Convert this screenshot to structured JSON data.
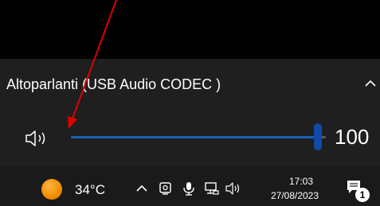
{
  "flyout": {
    "device_label": "Altoparlanti (USB Audio CODEC )",
    "volume_value": "100",
    "volume_level": 1.0
  },
  "taskbar": {
    "temperature": "34°C",
    "clock_time": "17:03",
    "clock_date": "27/08/2023",
    "notification_count": "1"
  },
  "colors": {
    "flyout_bg": "#1f1f1f",
    "taskbar_bg": "#1a1a1a",
    "slider_accent": "#1a5fb4",
    "annotation_arrow": "#e00000"
  },
  "icons": {
    "chevron": "chevron-up-icon",
    "speaker": "speaker-icon",
    "weather": "sun-icon",
    "tray_overflow": "chevron-up-icon",
    "camera": "camera-icon",
    "microphone": "microphone-icon",
    "network": "network-icon",
    "volume": "speaker-icon",
    "notifications": "notification-icon"
  }
}
